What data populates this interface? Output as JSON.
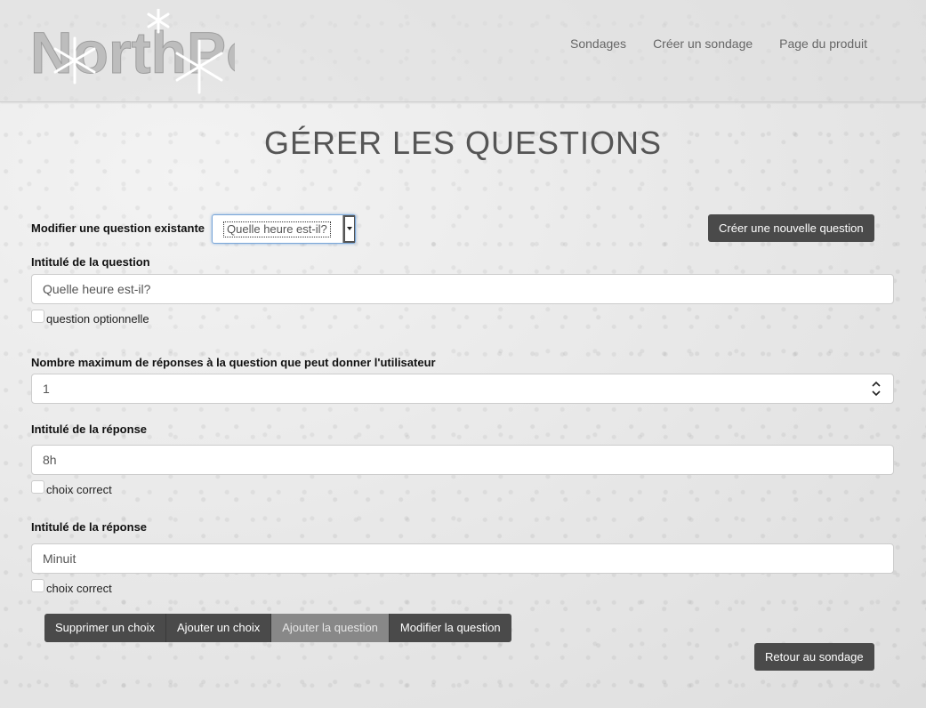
{
  "header": {
    "logo_text": "NorthPoll",
    "nav": [
      "Sondages",
      "Créer un sondage",
      "Page du produit"
    ]
  },
  "page_title": "GÉRER LES QUESTIONS",
  "edit_existing": {
    "label": "Modifier une question existante",
    "selected": "Quelle heure est-il?",
    "new_button": "Créer une nouvelle question"
  },
  "question": {
    "label": "Intitulé de la question",
    "value": "Quelle heure est-il?",
    "optional_label": "question optionnelle",
    "optional_checked": false
  },
  "max_answers": {
    "label": "Nombre maximum de réponses à la question que peut donner l'utilisateur",
    "value": "1"
  },
  "answers": [
    {
      "label": "Intitulé de la réponse",
      "value": "8h",
      "correct_label": "choix correct",
      "correct": false
    },
    {
      "label": "Intitulé de la réponse",
      "value": "Minuit",
      "correct_label": "choix correct",
      "correct": false
    }
  ],
  "actions": {
    "remove_choice": "Supprimer un choix",
    "add_choice": "Ajouter un choix",
    "add_question": "Ajouter la question",
    "edit_question": "Modifier la question",
    "back": "Retour au sondage"
  },
  "icons": {
    "logo_snowflake": "snowflake-icon",
    "select_caret": "caret-down-icon",
    "number_spinner": "spinner-arrows-icon"
  },
  "colors": {
    "button": "#4a4a4a",
    "button_disabled": "#888888",
    "focus_ring": "#7aa7d9"
  }
}
